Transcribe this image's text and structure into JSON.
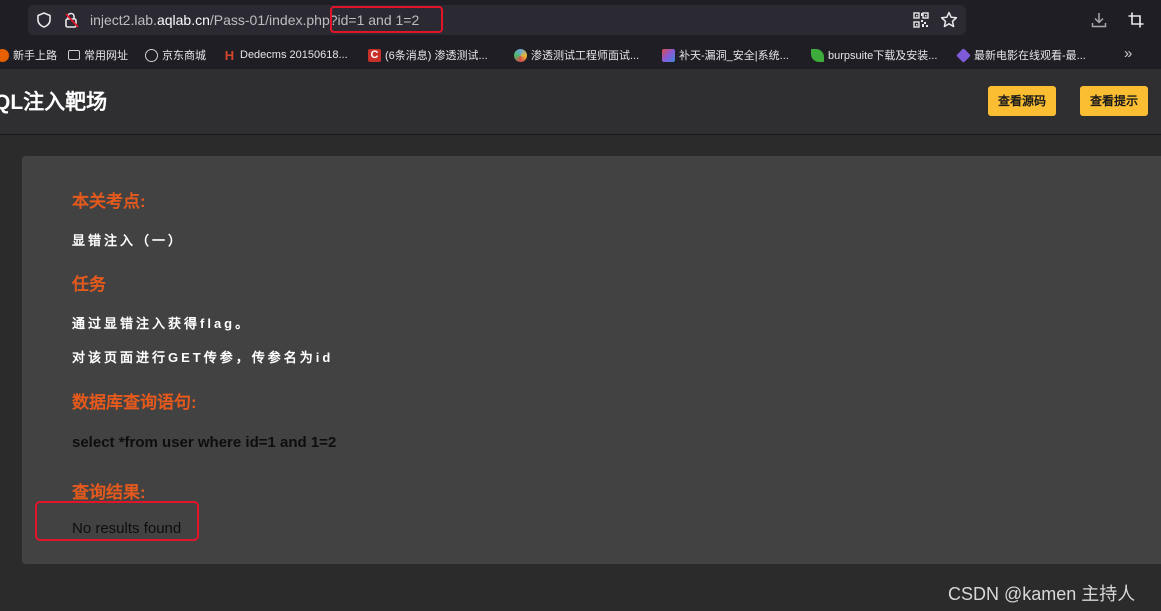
{
  "browser": {
    "url_prefix": "inject2.lab.",
    "url_host": "aqlab.cn",
    "url_path": "/Pass-01/index.php",
    "url_query": "?id=1 and 1=2"
  },
  "bookmarks": {
    "items": [
      {
        "label": "新手上路",
        "icon": "firefox-icon",
        "color": "#e66000"
      },
      {
        "label": "常用网址",
        "icon": "folder-icon",
        "color": "#cfcfd2"
      },
      {
        "label": "京东商城",
        "icon": "globe-icon",
        "color": "#cfcfd2"
      },
      {
        "label": "Dedecms 20150618...",
        "icon": "h-icon",
        "color": "#d9452b"
      },
      {
        "label": "(6条消息) 渗透测试...",
        "icon": "csdn-c-icon",
        "color": "#c8302a"
      },
      {
        "label": "渗透测试工程师面试...",
        "icon": "pinwheel-icon",
        "color": "#6aa6d8"
      },
      {
        "label": "补天-漏洞_安全|系统...",
        "icon": "star-mosaic-icon",
        "color": "#8a5ad8"
      },
      {
        "label": "burpsuite下载及安装...",
        "icon": "leaf-icon",
        "color": "#3dac3d"
      },
      {
        "label": "最新电影在线观看-最...",
        "icon": "gem-icon",
        "color": "#7e5ad8"
      }
    ],
    "more": "»"
  },
  "header": {
    "title": "QL注入靶场",
    "source_button": "查看源码",
    "hint_button": "查看提示"
  },
  "content": {
    "topic_heading": "本关考点:",
    "topic_text": "显错注入（一）",
    "task_heading": "任务",
    "task_line1": "通过显错注入获得flag。",
    "task_line2": "对该页面进行GET传参，传参名为id",
    "query_heading": "数据库查询语句:",
    "query_text": "select *from user where id=1 and 1=2",
    "result_heading": "查询结果:",
    "result_text": "No results found"
  },
  "watermark": "CSDN @kamen 主持人"
}
